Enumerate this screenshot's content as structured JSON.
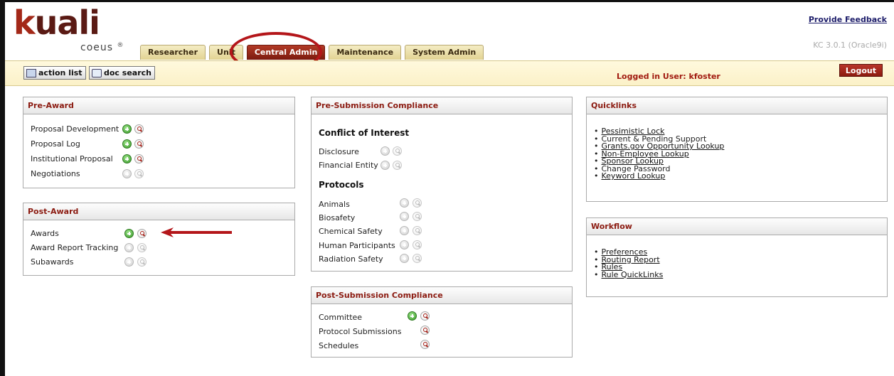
{
  "app": {
    "logo_text": "kuali",
    "logo_sub": "coeus",
    "logo_mark": "®"
  },
  "tabs": [
    {
      "label": "Researcher"
    },
    {
      "label": "Unit"
    },
    {
      "label": "Central Admin"
    },
    {
      "label": "Maintenance"
    },
    {
      "label": "System Admin"
    }
  ],
  "header": {
    "feedback_label": "Provide Feedback",
    "version": "KC 3.0.1 (Oracle9i)"
  },
  "toolbar": {
    "action_list_label": "action list",
    "doc_search_label": "doc search",
    "logged_in": "Logged in User: kfoster",
    "logout_label": "Logout"
  },
  "pre_award": {
    "title": "Pre-Award",
    "items": [
      {
        "label": "Proposal Development"
      },
      {
        "label": "Proposal Log"
      },
      {
        "label": "Institutional Proposal"
      },
      {
        "label": "Negotiations"
      }
    ]
  },
  "post_award": {
    "title": "Post-Award",
    "items": [
      {
        "label": "Awards"
      },
      {
        "label": "Award Report Tracking"
      },
      {
        "label": "Subawards"
      }
    ]
  },
  "pre_submission": {
    "title": "Pre-Submission Compliance",
    "coi_heading": "Conflict of Interest",
    "coi_items": [
      {
        "label": "Disclosure"
      },
      {
        "label": "Financial Entity"
      }
    ],
    "protocols_heading": "Protocols",
    "protocol_items": [
      {
        "label": "Animals"
      },
      {
        "label": "Biosafety"
      },
      {
        "label": "Chemical Safety"
      },
      {
        "label": "Human Participants"
      },
      {
        "label": "Radiation Safety"
      }
    ]
  },
  "post_submission": {
    "title": "Post-Submission Compliance",
    "items": [
      {
        "label": "Committee"
      },
      {
        "label": "Protocol Submissions"
      },
      {
        "label": "Schedules"
      }
    ]
  },
  "quicklinks": {
    "title": "Quicklinks",
    "links": [
      {
        "label": "Pessimistic Lock"
      },
      {
        "label": "Current & Pending Support"
      },
      {
        "label": "Grants.gov Opportunity Lookup"
      },
      {
        "label": "Non-Employee Lookup"
      },
      {
        "label": "Sponsor Lookup"
      },
      {
        "label": "Change Password"
      },
      {
        "label": "Keyword Lookup"
      }
    ]
  },
  "workflow": {
    "title": "Workflow",
    "links": [
      {
        "label": "Preferences"
      },
      {
        "label": "Routing Report"
      },
      {
        "label": "Rules"
      },
      {
        "label": "Rule QuickLinks"
      }
    ]
  },
  "colors": {
    "brand": "#8b1a10",
    "active_tab": "#9a2a18",
    "highlight": "#b4161a"
  }
}
